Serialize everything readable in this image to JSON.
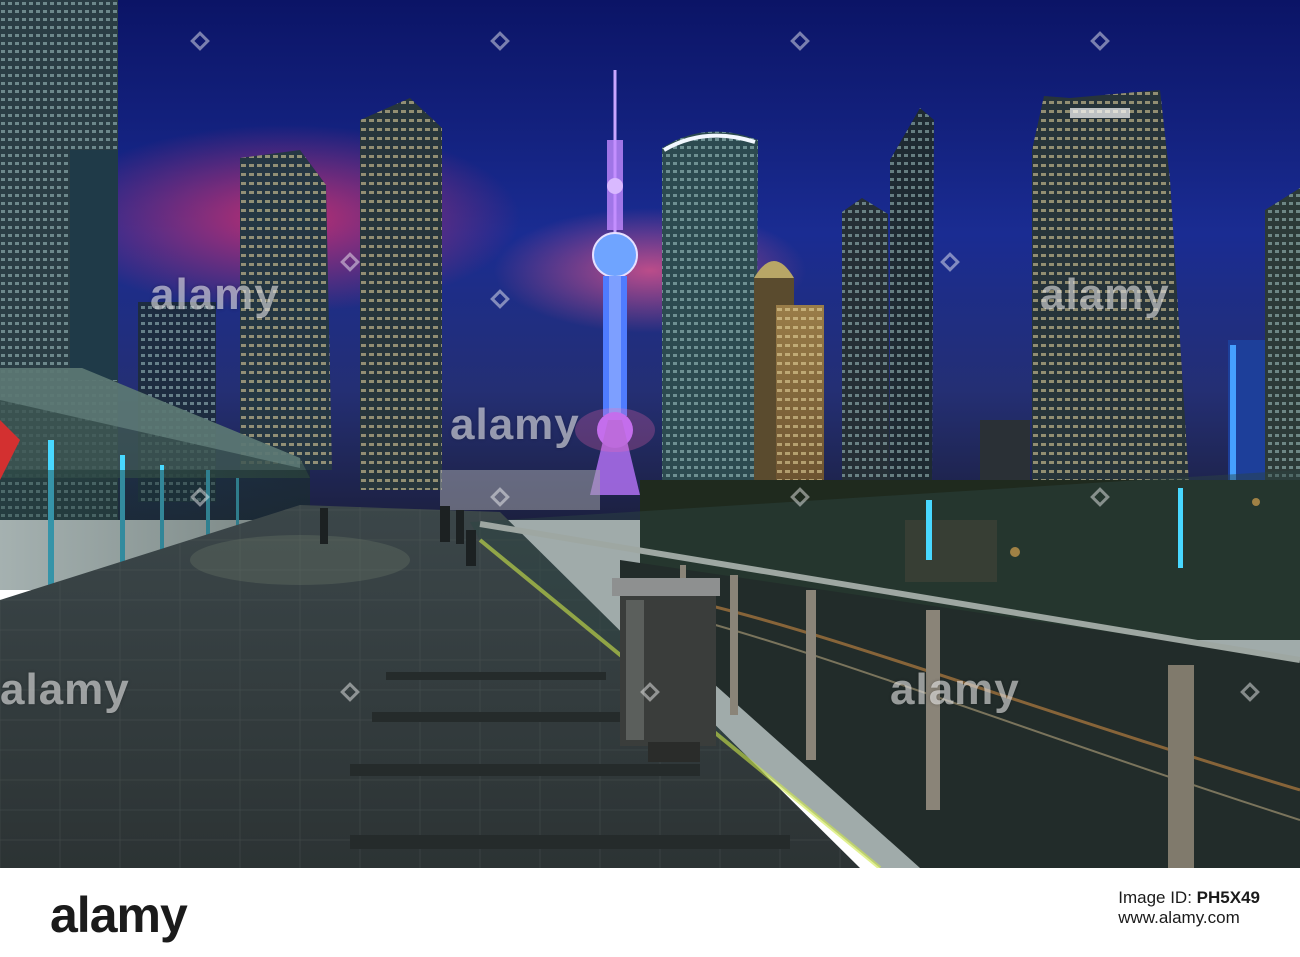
{
  "watermark": {
    "text": "alamy",
    "colors": {
      "sky_top": "#0b1666",
      "sky_mid": "#1a2f9a",
      "tower_glow": "#9f7bff",
      "floor": "#3f4a4c"
    }
  },
  "footer": {
    "brand": "alamy",
    "image_id_label": "Image ID:",
    "image_id": "PH5X49",
    "url": "www.alamy.com"
  }
}
